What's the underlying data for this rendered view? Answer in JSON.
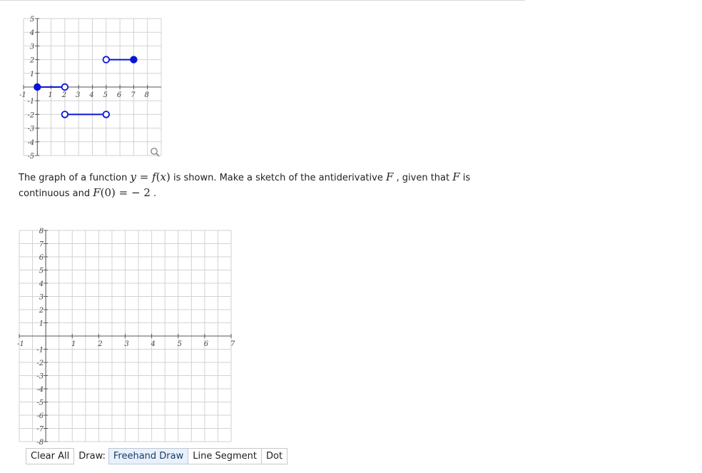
{
  "graph1": {
    "x_ticks": [
      "-1",
      "1",
      "2",
      "3",
      "4",
      "5",
      "6",
      "7",
      "8"
    ],
    "y_ticks": [
      "5",
      "4",
      "3",
      "2",
      "1",
      "-1",
      "-2",
      "-3",
      "-4",
      "-5"
    ],
    "segments": [
      {
        "x1": 0,
        "x2": 2,
        "y": 0,
        "left": "closed",
        "right": "open"
      },
      {
        "x1": 2,
        "x2": 5,
        "y": -2,
        "left": "open",
        "right": "open"
      },
      {
        "x1": 5,
        "x2": 7,
        "y": 2,
        "left": "open",
        "right": "closed"
      }
    ],
    "line_color": "#0a14d8",
    "zoom_icon": "magnifier-icon"
  },
  "prompt": {
    "p1": "The graph of a function ",
    "m1": "y",
    "m2": " = ",
    "m3": "f",
    "m4": "(",
    "m5": "x",
    "m6": ")",
    "p2": "  is shown.  Make a sketch of the antiderivative ",
    "m7": "F",
    "p3": " , given that ",
    "m8": "F",
    "p4": "  is continuous and ",
    "m9": "F",
    "m10": "(0)",
    "m11": " = ",
    "m12": " − 2",
    "p5": " ."
  },
  "graph2": {
    "x_ticks": [
      "-1",
      "1",
      "2",
      "3",
      "4",
      "5",
      "6",
      "7"
    ],
    "y_ticks": [
      "8",
      "7",
      "6",
      "5",
      "4",
      "3",
      "2",
      "1",
      "-1",
      "-2",
      "-3",
      "-4",
      "-5",
      "-6",
      "-7",
      "-8"
    ]
  },
  "toolbar": {
    "clear_all": "Clear All",
    "draw_label": "Draw:",
    "freehand": "Freehand Draw",
    "line_segment": "Line Segment",
    "dot": "Dot"
  }
}
